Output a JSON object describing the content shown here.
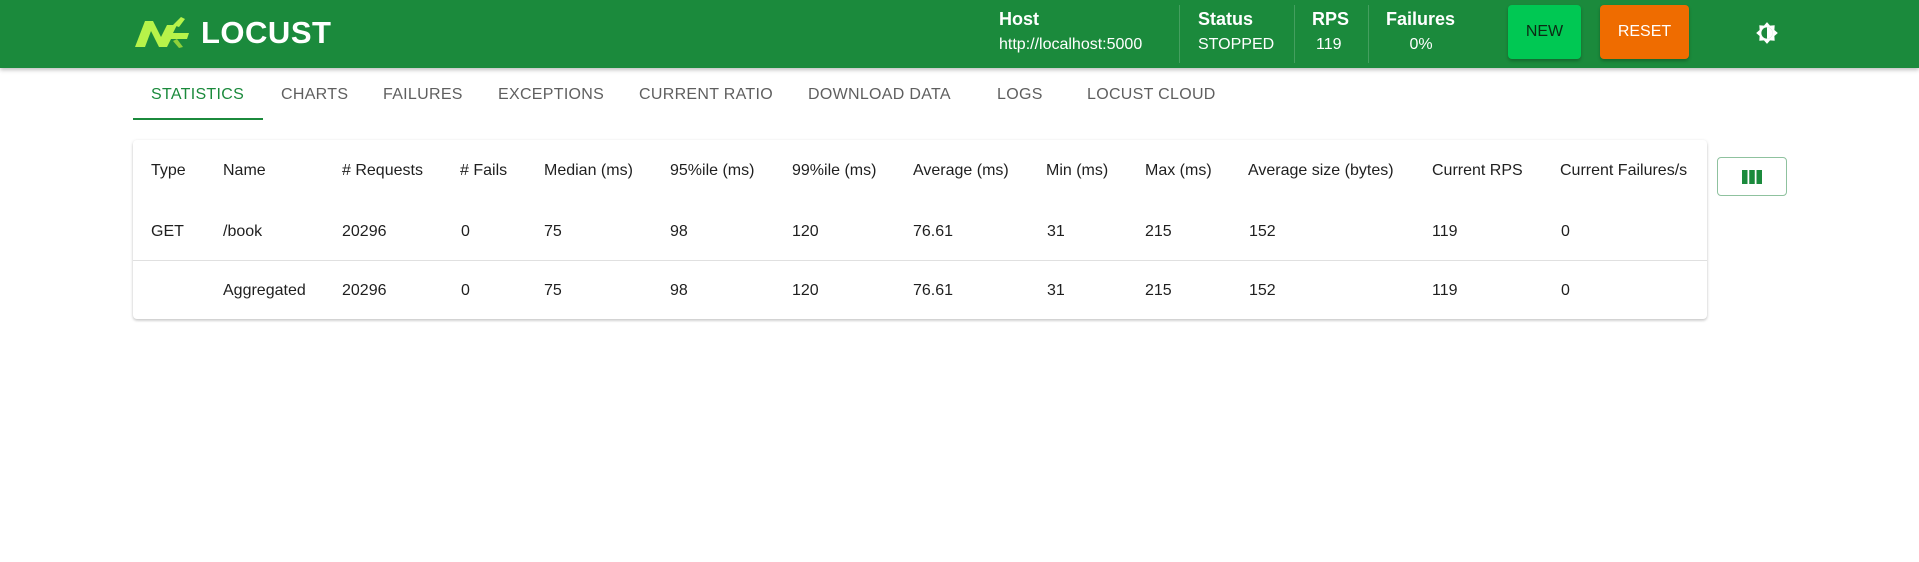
{
  "app": {
    "logo_text": "LOCUST"
  },
  "header": {
    "host": {
      "label": "Host",
      "value": "http://localhost:5000"
    },
    "status": {
      "label": "Status",
      "value": "STOPPED"
    },
    "rps": {
      "label": "RPS",
      "value": "119"
    },
    "failures": {
      "label": "Failures",
      "value": "0%"
    },
    "new_label": "NEW",
    "reset_label": "RESET"
  },
  "tabs": [
    {
      "label": "STATISTICS",
      "active": true
    },
    {
      "label": "CHARTS"
    },
    {
      "label": "FAILURES"
    },
    {
      "label": "EXCEPTIONS"
    },
    {
      "label": "CURRENT RATIO"
    },
    {
      "label": "DOWNLOAD DATA"
    },
    {
      "label": "LOGS"
    },
    {
      "label": "LOCUST CLOUD"
    }
  ],
  "table": {
    "columns": [
      "Type",
      "Name",
      "# Requests",
      "# Fails",
      "Median (ms)",
      "95%ile (ms)",
      "99%ile (ms)",
      "Average (ms)",
      "Min (ms)",
      "Max (ms)",
      "Average size (bytes)",
      "Current RPS",
      "Current Failures/s"
    ],
    "rows": [
      [
        "GET",
        "/book",
        "20296",
        "0",
        "75",
        "98",
        "120",
        "76.61",
        "31",
        "215",
        "152",
        "119",
        "0"
      ],
      [
        "",
        "Aggregated",
        "20296",
        "0",
        "75",
        "98",
        "120",
        "76.61",
        "31",
        "215",
        "152",
        "119",
        "0"
      ]
    ]
  },
  "colors": {
    "brand": "#1b8a3c",
    "new_button": "#00c853",
    "reset_button": "#ef6c00",
    "logo_accent": "#b7f34a"
  },
  "icons": {
    "logo": "grasshopper-logo-icon",
    "theme": "brightness-icon",
    "columns": "view-columns-icon"
  }
}
